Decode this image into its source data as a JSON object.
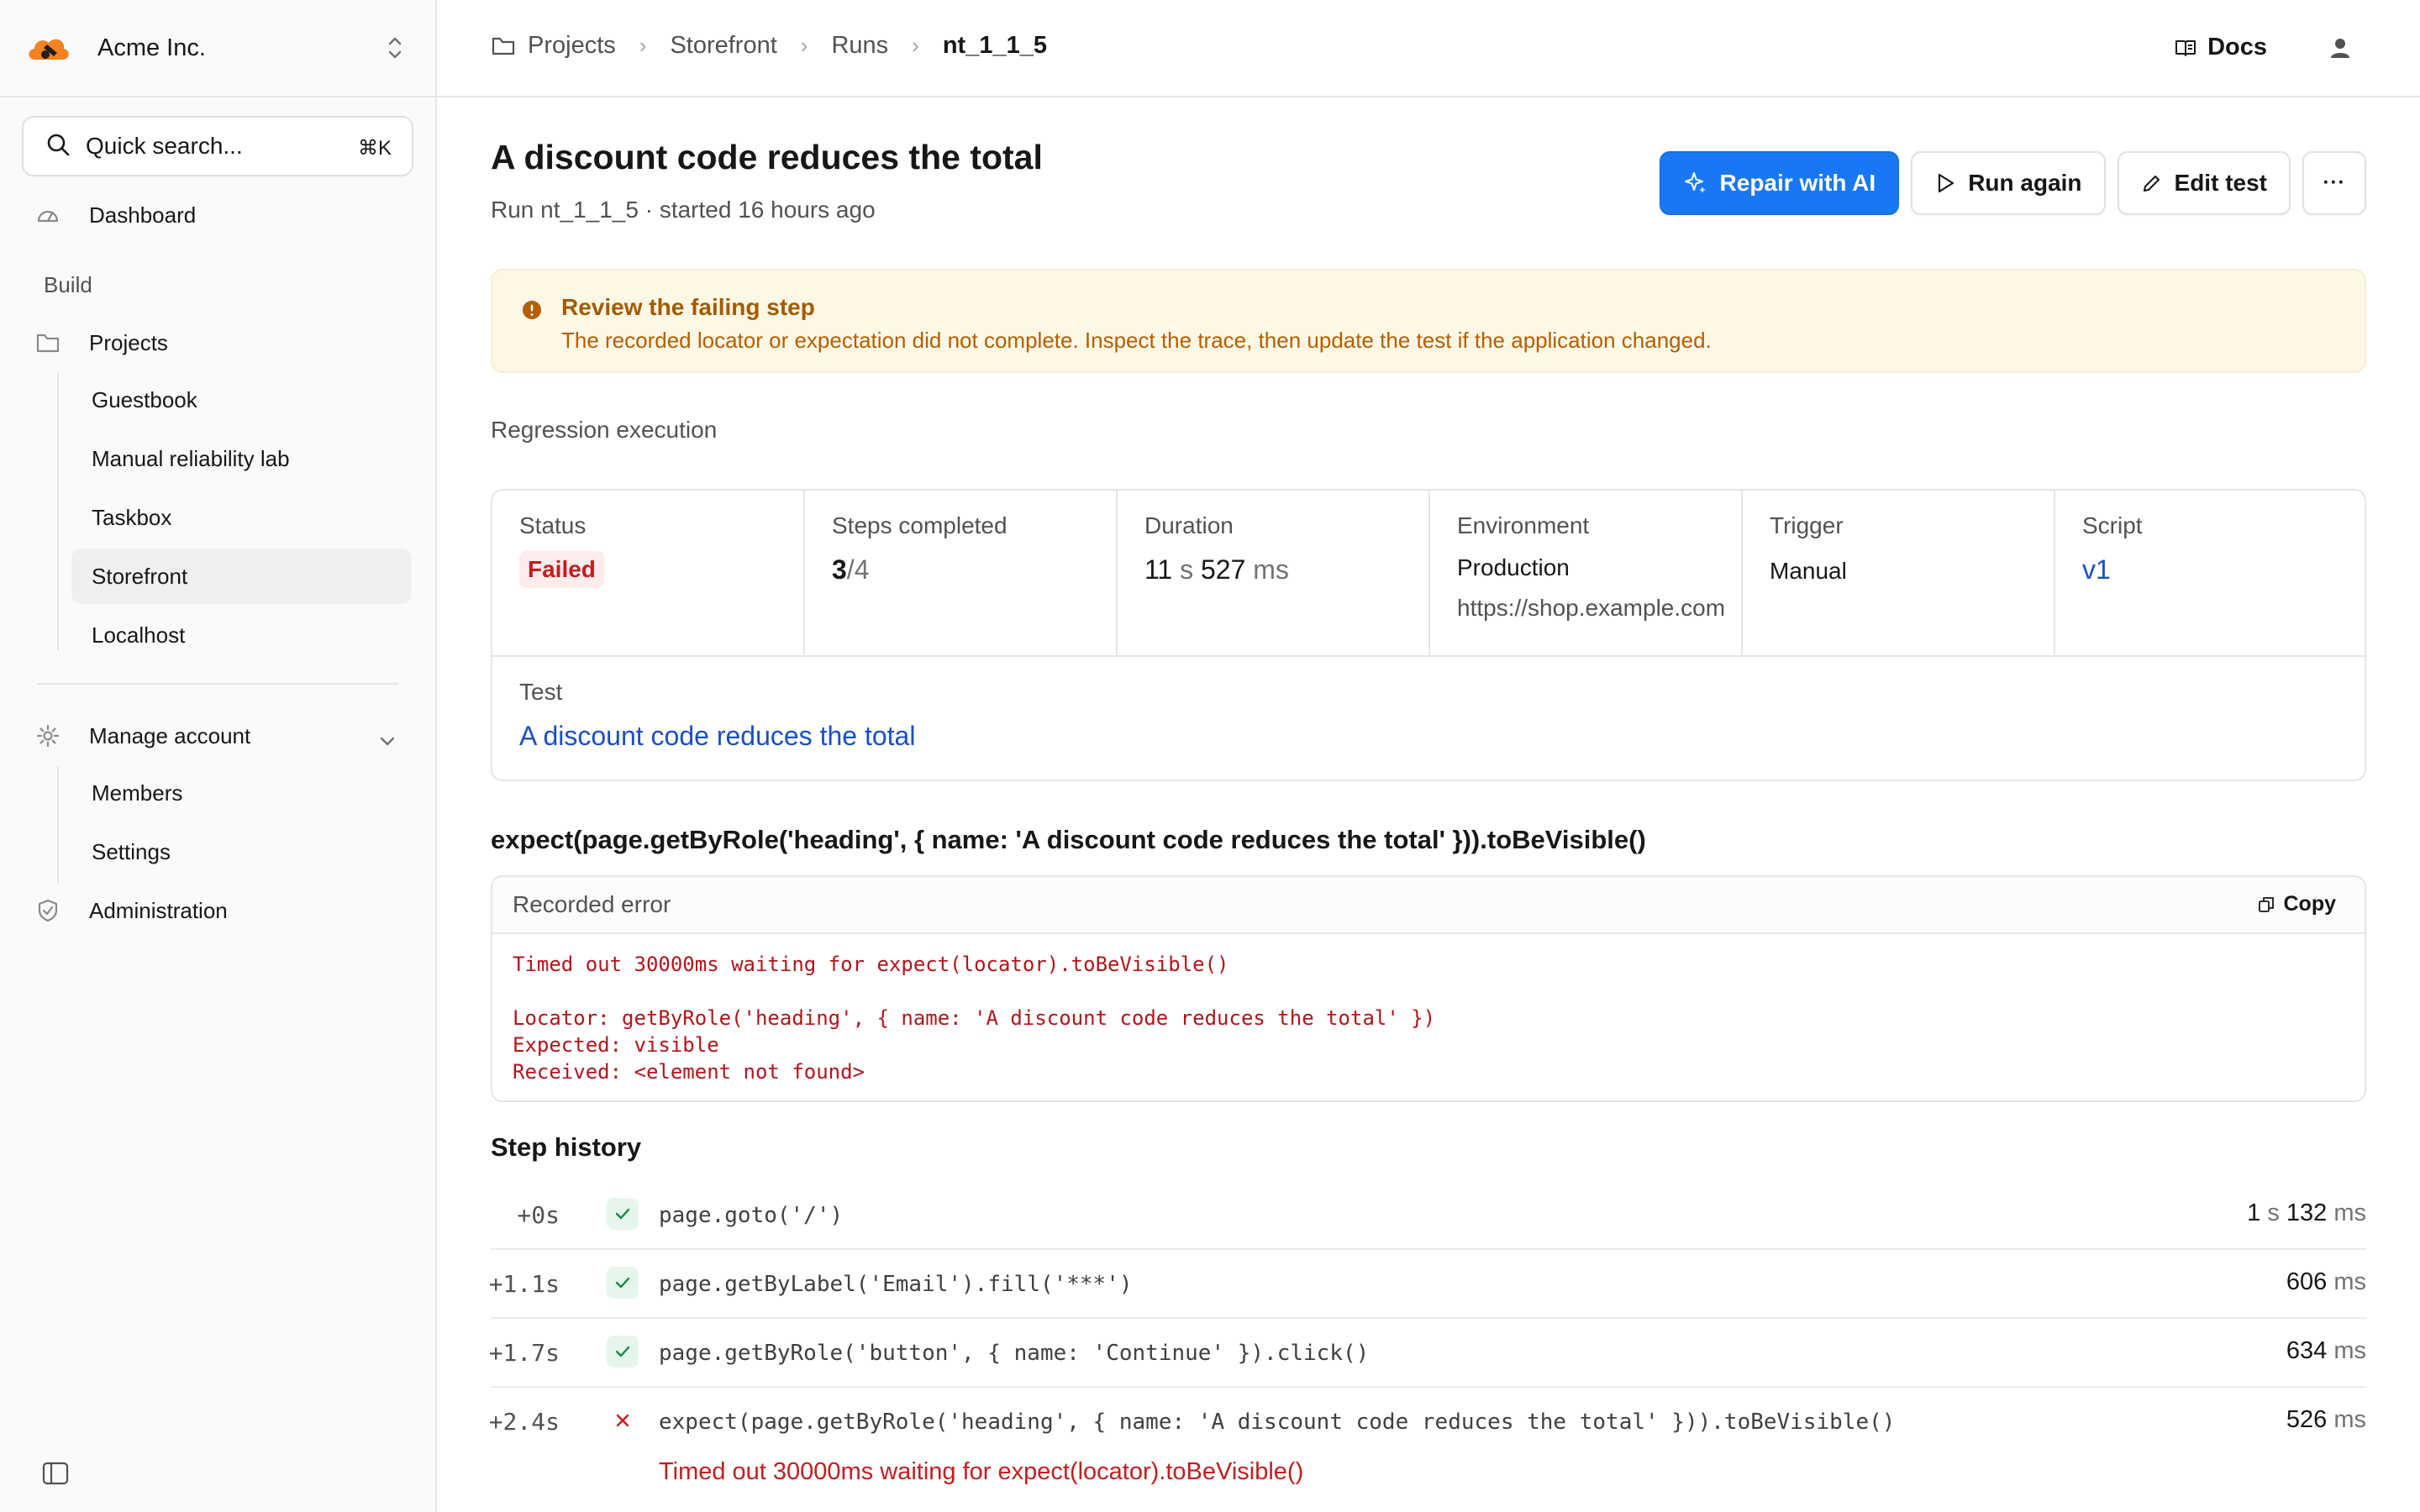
{
  "org": {
    "name": "Acme Inc."
  },
  "search": {
    "placeholder": "Quick search...",
    "shortcut": "⌘K"
  },
  "sidebar": {
    "dashboard": "Dashboard",
    "build_section": "Build",
    "projects": "Projects",
    "project_items": [
      "Guestbook",
      "Manual reliability lab",
      "Taskbox",
      "Storefront",
      "Localhost"
    ],
    "active_project": "Storefront",
    "manage_account": "Manage account",
    "account_items": [
      "Members",
      "Settings"
    ],
    "administration": "Administration"
  },
  "breadcrumb": {
    "projects": "Projects",
    "project": "Storefront",
    "runs": "Runs",
    "run": "nt_1_1_5"
  },
  "header": {
    "docs": "Docs"
  },
  "page": {
    "title": "A discount code reduces the total",
    "subtitle": "Run nt_1_1_5  · started 16 hours ago"
  },
  "actions": {
    "repair": "Repair with AI",
    "run_again": "Run again",
    "edit": "Edit test",
    "more": "···"
  },
  "alert": {
    "title": "Review the failing step",
    "body": "The recorded locator or expectation did not complete. Inspect the trace, then update the test if the application changed."
  },
  "section_label": "Regression execution",
  "summary": {
    "status": {
      "label": "Status",
      "value": "Failed"
    },
    "steps": {
      "label": "Steps completed",
      "done": "3",
      "total": "/4"
    },
    "duration": {
      "label": "Duration",
      "s": "11",
      "s_unit": " s ",
      "ms": "527",
      "ms_unit": " ms"
    },
    "environment": {
      "label": "Environment",
      "name": "Production",
      "url": "https://shop.example.com"
    },
    "trigger": {
      "label": "Trigger",
      "value": "Manual"
    },
    "script": {
      "label": "Script",
      "value": "v1"
    },
    "test": {
      "label": "Test",
      "value": "A discount code reduces the total"
    }
  },
  "assertion": "expect(page.getByRole('heading', { name: 'A discount code reduces the total' })).toBeVisible()",
  "error": {
    "label": "Recorded error",
    "copy": "Copy",
    "text": "Timed out 30000ms waiting for expect(locator).toBeVisible()\n\nLocator: getByRole('heading', { name: 'A discount code reduces the total' })\nExpected: visible\nReceived: <element not found>"
  },
  "history": {
    "title": "Step history",
    "steps": [
      {
        "offset": "+0s",
        "status": "passed",
        "code": "page.goto('/')",
        "dur_a": "1",
        "unit_a": " s ",
        "dur_b": "132",
        "unit_b": " ms"
      },
      {
        "offset": "+1.1s",
        "status": "passed",
        "code": "page.getByLabel('Email').fill('***')",
        "dur_a": "",
        "unit_a": "",
        "dur_b": "606",
        "unit_b": " ms"
      },
      {
        "offset": "+1.7s",
        "status": "passed",
        "code": "page.getByRole('button', { name: 'Continue' }).click()",
        "dur_a": "",
        "unit_a": "",
        "dur_b": "634",
        "unit_b": " ms"
      },
      {
        "offset": "+2.4s",
        "status": "failed",
        "code": "expect(page.getByRole('heading', { name: 'A discount code reduces the total' })).toBeVisible()",
        "dur_a": "",
        "unit_a": "",
        "dur_b": "526",
        "unit_b": " ms"
      }
    ],
    "failure_message": "Timed out 30000ms waiting for expect(locator).toBeVisible()"
  },
  "colors": {
    "primary": "#1877f2",
    "failed": "#c41d1d",
    "warning_bg": "#fdf7e6",
    "link": "#1a4fc4"
  }
}
